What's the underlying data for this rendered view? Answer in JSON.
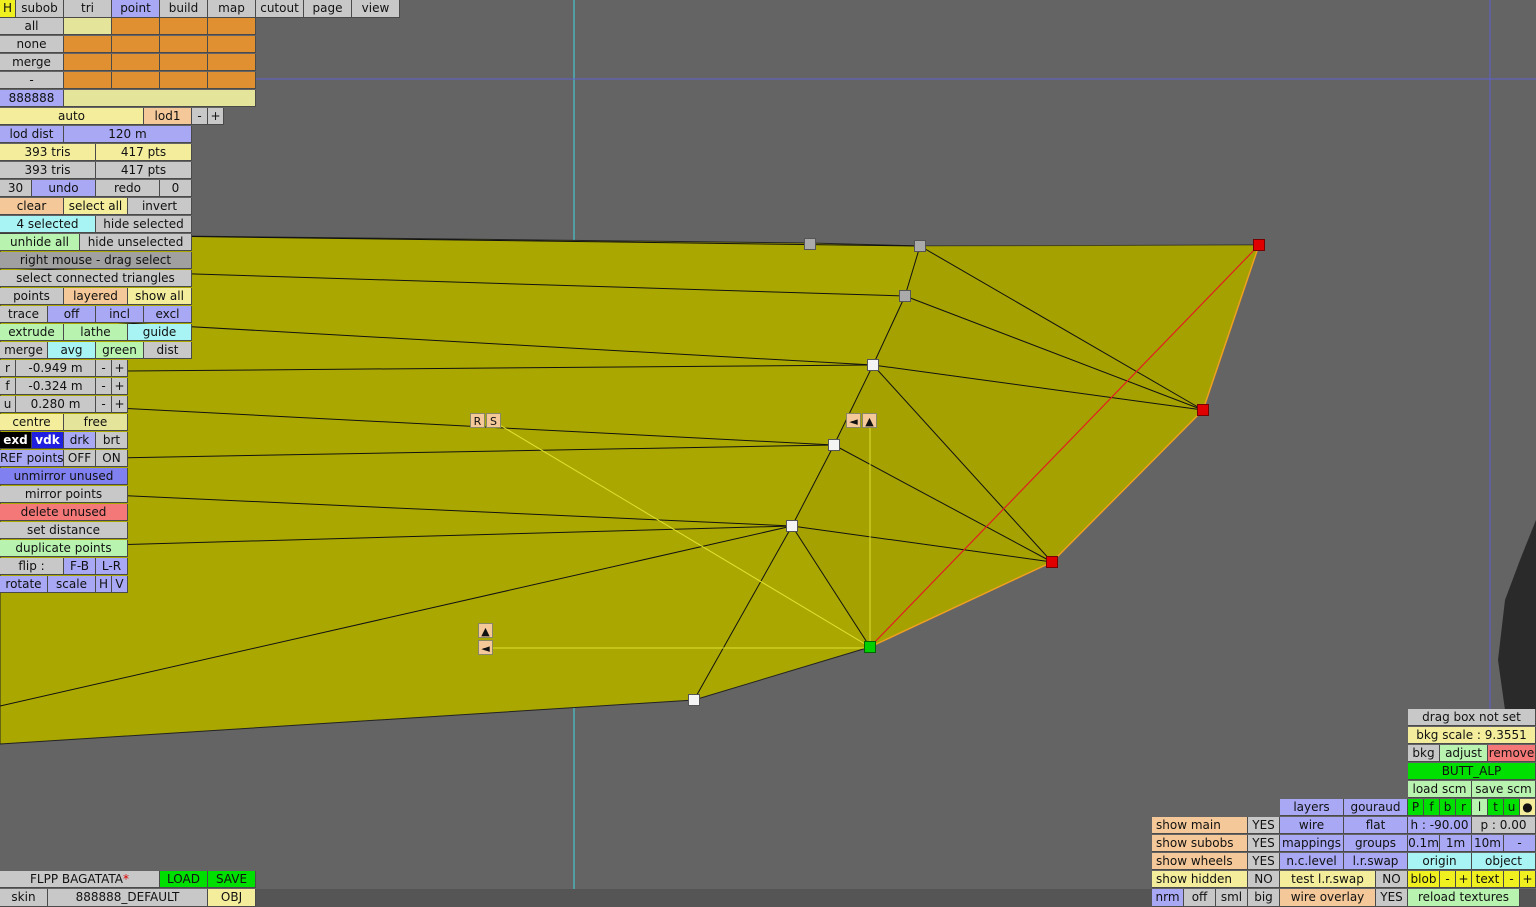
{
  "top_tabs": [
    "H",
    "subob",
    "tri",
    "point",
    "build",
    "map",
    "cutout",
    "page",
    "view"
  ],
  "active_tab": "point",
  "left_panel": {
    "rows_a": [
      "all",
      "none",
      "merge",
      "-"
    ],
    "color_code": "888888",
    "auto": "auto",
    "lod": "lod1",
    "minus": "-",
    "plus": "+",
    "lod_dist_label": "lod dist",
    "lod_dist_value": "120 m",
    "tris_1": "393 tris",
    "pts_1": "417 pts",
    "tris_2": "393 tris",
    "pts_2": "417 pts",
    "undo_count": "30",
    "undo": "undo",
    "redo": "redo",
    "redo_count": "0",
    "clear": "clear",
    "select_all": "select all",
    "invert": "invert",
    "selected": "4 selected",
    "hide_selected": "hide selected",
    "unhide_all": "unhide all",
    "hide_unselected": "hide unselected",
    "right_mouse": "right mouse - drag select",
    "select_connected": "select connected triangles",
    "points": "points",
    "layered": "layered",
    "show_all": "show all",
    "trace": "trace",
    "off": "off",
    "incl": "incl",
    "excl": "excl",
    "extrude": "extrude",
    "lathe": "lathe",
    "guide": "guide",
    "merge2": "merge",
    "avg": "avg",
    "green": "green",
    "dist": "dist",
    "r_label": "r",
    "r_value": "-0.949 m",
    "f_label": "f",
    "f_value": "-0.324 m",
    "u_label": "u",
    "u_value": "0.280 m",
    "centre": "centre",
    "free": "free",
    "exd": "exd",
    "vdk": "vdk",
    "drk": "drk",
    "brt": "brt",
    "ref_points": "REF points",
    "ref_off": "OFF",
    "ref_on": "ON",
    "unmirror_unused": "unmirror unused",
    "mirror_points": "mirror points",
    "delete_unused": "delete unused",
    "set_distance": "set distance",
    "duplicate_points": "duplicate points",
    "flip": "flip :",
    "fb": "F-B",
    "lr": "L-R",
    "rotate": "rotate",
    "scale": "scale",
    "h": "H",
    "v": "V"
  },
  "bottom_left": {
    "car_name": "FLPP BAGATATA",
    "unsaved_mark": "*",
    "load": "LOAD",
    "save": "SAVE",
    "skin": "skin",
    "skin_name": "888888_DEFAULT",
    "obj": "OBJ"
  },
  "viewport_tags": {
    "r": "R",
    "s": "S",
    "left_arrow": "◄",
    "up_arrow": "▲"
  },
  "bottom_right": {
    "drag_box": "drag box not set",
    "bkg_scale": "bkg scale : 9.3551",
    "bkg": "bkg",
    "adjust": "adjust",
    "remove": "remove",
    "butt_alp": "BUTT_ALP",
    "load_scm": "load scm",
    "save_scm": "save scm",
    "view_letters": [
      "P",
      "f",
      "b",
      "r",
      "l",
      "t",
      "u",
      "●"
    ],
    "h_value": "h : -90.00",
    "p_value": "p : 0.00",
    "step_01": "0.1m",
    "step_1": "1m",
    "step_10": "10m",
    "step_minus": "-",
    "origin": "origin",
    "object": "object",
    "blob": "blob",
    "text": "text",
    "minus": "-",
    "plus": "+",
    "reload_textures": "reload textures",
    "layers": "layers",
    "gouraud": "gouraud",
    "wire": "wire",
    "flat": "flat",
    "mappings": "mappings",
    "groups": "groups",
    "nc_level": "n.c.level",
    "lr_swap": "l.r.swap",
    "test_lr_swap": "test l.r.swap",
    "test_no": "NO",
    "wire_overlay": "wire overlay",
    "wire_overlay_yes": "YES",
    "show_main": "show main",
    "show_main_v": "YES",
    "show_subobs": "show subobs",
    "show_subobs_v": "YES",
    "show_wheels": "show wheels",
    "show_wheels_v": "YES",
    "show_hidden": "show hidden",
    "show_hidden_v": "NO",
    "nrm": "nrm",
    "off": "off",
    "sml": "sml",
    "big": "big"
  }
}
